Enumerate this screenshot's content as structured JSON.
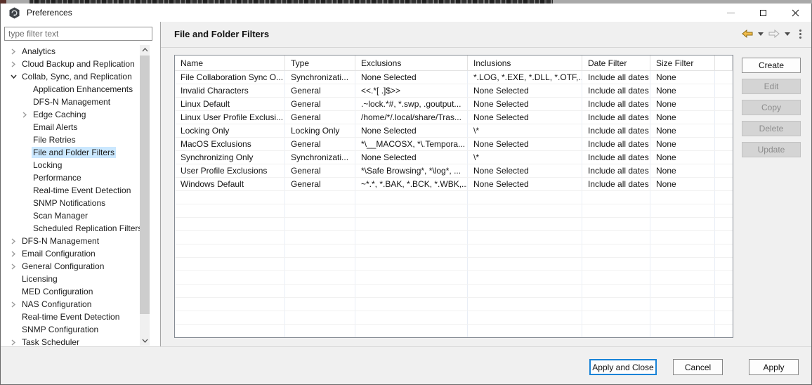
{
  "window": {
    "title": "Preferences",
    "icon": "peer-hexagon-logo",
    "controls": {
      "minimize": "minimize",
      "maximize": "maximize",
      "close": "✕"
    }
  },
  "sidebar": {
    "filter_placeholder": "type filter text",
    "tree": [
      {
        "label": "Analytics",
        "level": 0,
        "state": "collapsed"
      },
      {
        "label": "Cloud Backup and Replication",
        "level": 0,
        "state": "collapsed"
      },
      {
        "label": "Collab, Sync, and Replication",
        "level": 0,
        "state": "expanded"
      },
      {
        "label": "Application Enhancements",
        "level": 1,
        "state": "leaf"
      },
      {
        "label": "DFS-N Management",
        "level": 1,
        "state": "leaf"
      },
      {
        "label": "Edge Caching",
        "level": 1,
        "state": "collapsed"
      },
      {
        "label": "Email Alerts",
        "level": 1,
        "state": "leaf"
      },
      {
        "label": "File Retries",
        "level": 1,
        "state": "leaf"
      },
      {
        "label": "File and Folder Filters",
        "level": 1,
        "state": "leaf",
        "selected": true
      },
      {
        "label": "Locking",
        "level": 1,
        "state": "leaf"
      },
      {
        "label": "Performance",
        "level": 1,
        "state": "leaf"
      },
      {
        "label": "Real-time Event Detection",
        "level": 1,
        "state": "leaf"
      },
      {
        "label": "SNMP Notifications",
        "level": 1,
        "state": "leaf"
      },
      {
        "label": "Scan Manager",
        "level": 1,
        "state": "leaf"
      },
      {
        "label": "Scheduled Replication Filters",
        "level": 1,
        "state": "leaf"
      },
      {
        "label": "DFS-N Management",
        "level": 0,
        "state": "collapsed"
      },
      {
        "label": "Email Configuration",
        "level": 0,
        "state": "collapsed"
      },
      {
        "label": "General Configuration",
        "level": 0,
        "state": "collapsed"
      },
      {
        "label": "Licensing",
        "level": 0,
        "state": "leaf"
      },
      {
        "label": "MED Configuration",
        "level": 0,
        "state": "leaf"
      },
      {
        "label": "NAS Configuration",
        "level": 0,
        "state": "collapsed"
      },
      {
        "label": "Real-time Event Detection",
        "level": 0,
        "state": "leaf"
      },
      {
        "label": "SNMP Configuration",
        "level": 0,
        "state": "leaf"
      },
      {
        "label": "Task Scheduler",
        "level": 0,
        "state": "collapsed"
      }
    ]
  },
  "content": {
    "title": "File and Folder Filters",
    "nav": {
      "back_icon": "back-arrow",
      "forward_icon": "forward-arrow",
      "view_menu_icon": "view-menu-dots"
    },
    "table": {
      "columns": [
        "Name",
        "Type",
        "Exclusions",
        "Inclusions",
        "Date Filter",
        "Size Filter"
      ],
      "rows": [
        [
          "File Collaboration Sync O...",
          "Synchronizati...",
          "None Selected",
          "*.LOG, *.EXE, *.DLL, *.OTF,...",
          "Include all dates",
          "None"
        ],
        [
          "Invalid Characters",
          "General",
          "<<.*[ .]$>>",
          "None Selected",
          "Include all dates",
          "None"
        ],
        [
          "Linux Default",
          "General",
          ".~lock.*#, *.swp, .goutput...",
          "None Selected",
          "Include all dates",
          "None"
        ],
        [
          "Linux User Profile Exclusi...",
          "General",
          "/home/*/.local/share/Tras...",
          "None Selected",
          "Include all dates",
          "None"
        ],
        [
          "Locking Only",
          "Locking Only",
          "None Selected",
          "\\*",
          "Include all dates",
          "None"
        ],
        [
          "MacOS Exclusions",
          "General",
          "*\\__MACOSX, *\\.Tempora...",
          "None Selected",
          "Include all dates",
          "None"
        ],
        [
          "Synchronizing Only",
          "Synchronizati...",
          "None Selected",
          "\\*",
          "Include all dates",
          "None"
        ],
        [
          "User Profile Exclusions",
          "General",
          "*\\Safe Browsing*, *\\log*, ...",
          "None Selected",
          "Include all dates",
          "None"
        ],
        [
          "Windows Default",
          "General",
          "~*.*, *.BAK, *.BCK, *.WBK,...",
          "None Selected",
          "Include all dates",
          "None"
        ]
      ],
      "empty_filler_rows": 11
    },
    "actions": [
      {
        "label": "Create",
        "enabled": true
      },
      {
        "label": "Edit",
        "enabled": false
      },
      {
        "label": "Copy",
        "enabled": false
      },
      {
        "label": "Delete",
        "enabled": false
      },
      {
        "label": "Update",
        "enabled": false
      }
    ]
  },
  "footer": {
    "apply_and_close": "Apply and Close",
    "cancel": "Cancel",
    "apply": "Apply"
  },
  "colors": {
    "accent_blue": "#1883d7",
    "selection_blue": "#cbe8ff",
    "back_arrow_gold": "#f2bc4a",
    "panel_gray": "#f0f0f0",
    "disabled_button": "#d4d4d4"
  }
}
